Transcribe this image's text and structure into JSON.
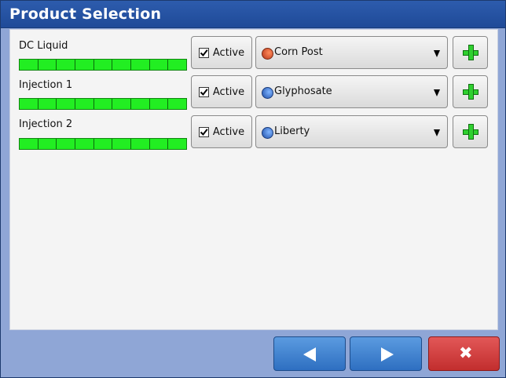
{
  "window": {
    "title": "Product Selection"
  },
  "rows": [
    {
      "label": "DC Liquid",
      "level": 1.0,
      "active_label": "Active",
      "checked": true,
      "product": "Corn Post",
      "product_icon": "corn-post-icon",
      "icon_color": "#d2522f"
    },
    {
      "label": "Injection 1",
      "level": 1.0,
      "active_label": "Active",
      "checked": true,
      "product": "Glyphosate",
      "product_icon": "glyphosate-icon",
      "icon_color": "#2f6fd0"
    },
    {
      "label": "Injection 2",
      "level": 1.0,
      "active_label": "Active",
      "checked": true,
      "product": "Liberty",
      "product_icon": "liberty-icon",
      "icon_color": "#2f6fd0"
    }
  ],
  "nav": {
    "back_icon": "arrow-left-icon",
    "next_icon": "arrow-right-icon",
    "cancel_icon": "close-icon"
  },
  "colors": {
    "title_bar": "#2455a8",
    "level_bar": "#22ee22",
    "nav_button": "#3a7fd0",
    "cancel_button": "#d23e3e",
    "add_icon": "#2fd02f"
  }
}
